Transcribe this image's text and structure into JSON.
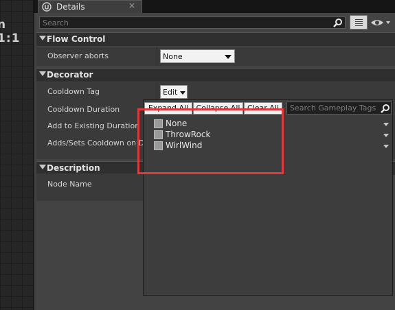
{
  "graph": {
    "partial_text": "n 1:1"
  },
  "tab": {
    "title": "Details",
    "close": "×"
  },
  "search": {
    "placeholder": "Search"
  },
  "sections": {
    "flow_control": {
      "title": "Flow Control",
      "observer_aborts_label": "Observer aborts",
      "observer_aborts_value": "None"
    },
    "decorator": {
      "title": "Decorator",
      "cooldown_tag_label": "Cooldown Tag",
      "edit_label": "Edit",
      "cooldown_duration_label": "Cooldown Duration",
      "add_existing_label": "Add to Existing Duration",
      "adds_sets_label": "Adds/Sets Cooldown on De"
    },
    "description": {
      "title": "Description",
      "node_name_label": "Node Name"
    }
  },
  "tag_picker": {
    "expand_all": "Expand All",
    "collapse_all": "Collapse All",
    "clear_all": "Clear All",
    "search_placeholder": "Search Gameplay Tags",
    "tags": [
      "None",
      "ThrowRock",
      "WirlWind"
    ]
  },
  "colors": {
    "highlight": "#e0393b",
    "panel": "#434343",
    "section_header": "#2f2f2f"
  }
}
